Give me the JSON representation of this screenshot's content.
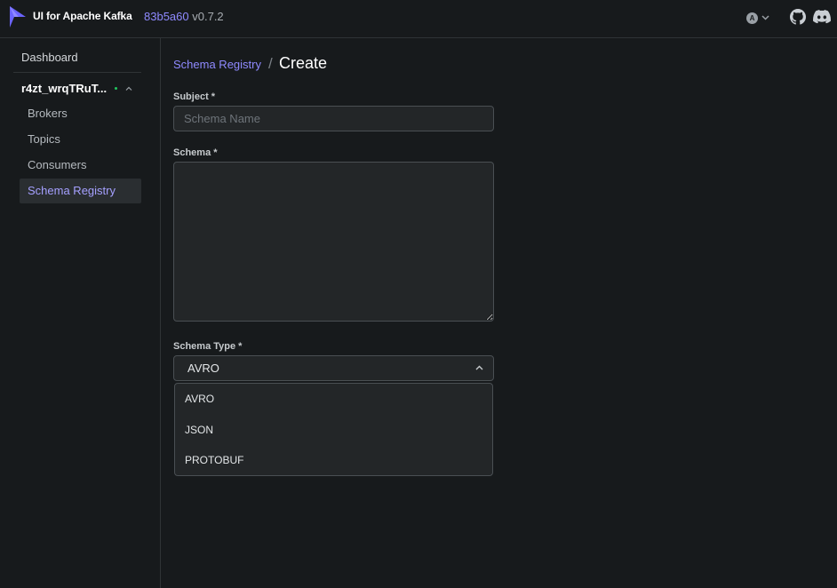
{
  "header": {
    "app_title": "UI for Apache Kafka",
    "commit": "83b5a60",
    "version": "v0.7.2",
    "theme_badge": "A",
    "icons": [
      "kafka-logo-icon",
      "theme-icon",
      "chevron-down-icon",
      "github-icon",
      "discord-icon"
    ],
    "accent_color": "#8f8aff"
  },
  "sidebar": {
    "dashboard_label": "Dashboard",
    "cluster": {
      "name": "r4zt_wrqTRuT...",
      "status_color": "#21c65e",
      "items": [
        {
          "label": "Brokers"
        },
        {
          "label": "Topics"
        },
        {
          "label": "Consumers"
        },
        {
          "label": "Schema Registry",
          "active": true
        }
      ]
    }
  },
  "breadcrumb": {
    "parent": "Schema Registry",
    "separator": "/",
    "current": "Create"
  },
  "form": {
    "subject_label": "Subject *",
    "subject_placeholder": "Schema Name",
    "subject_value": "",
    "schema_label": "Schema *",
    "schema_value": "",
    "type_label": "Schema Type *",
    "type_selected": "AVRO",
    "type_options": [
      "AVRO",
      "JSON",
      "PROTOBUF"
    ]
  }
}
